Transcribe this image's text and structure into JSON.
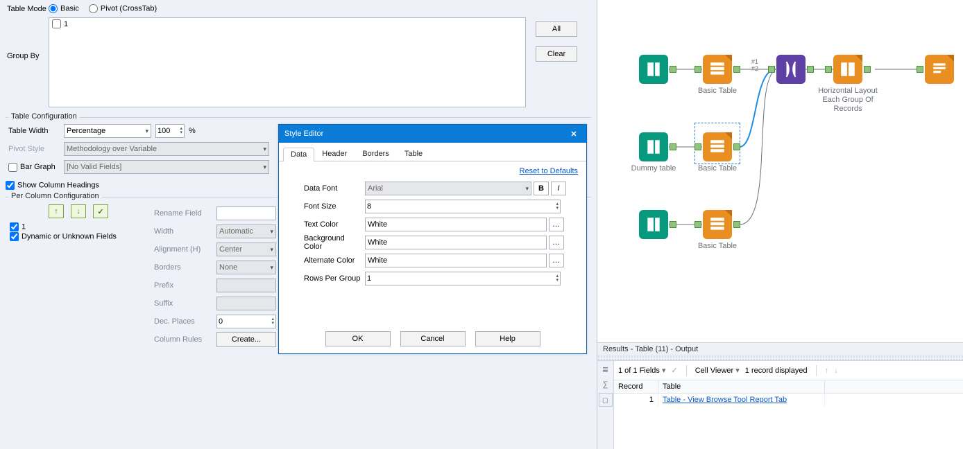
{
  "mode": {
    "label": "Table Mode",
    "basic": "Basic",
    "pivot": "Pivot (CrossTab)"
  },
  "groupby": {
    "label": "Group By",
    "item1": "1",
    "all_btn": "All",
    "clear_btn": "Clear"
  },
  "tblconf": {
    "legend": "Table Configuration",
    "width_lbl": "Table Width",
    "width_mode": "Percentage",
    "width_val": "100",
    "pct": "%",
    "pivot_lbl": "Pivot Style",
    "pivot_val": "Methodology over Variable",
    "bar_lbl": "Bar Graph",
    "bar_val": "[No Valid Fields]",
    "headings": "Show Column Headings"
  },
  "percol": {
    "legend": "Per Column Configuration",
    "f1": "1",
    "fdyn": "Dynamic or Unknown Fields",
    "rename": "Rename Field",
    "width_l": "Width",
    "width_v": "Automatic",
    "align_l": "Alignment (H)",
    "align_v": "Center",
    "borders_l": "Borders",
    "borders_v": "None",
    "prefix_l": "Prefix",
    "suffix_l": "Suffix",
    "dec_l": "Dec. Places",
    "dec_v": "0",
    "rules_l": "Column Rules",
    "rules_btn": "Create..."
  },
  "style": {
    "title": "Style Editor",
    "tabs": {
      "data": "Data",
      "header": "Header",
      "borders": "Borders",
      "table": "Table"
    },
    "reset": "Reset to Defaults",
    "font_l": "Data Font",
    "font_v": "Arial",
    "size_l": "Font Size",
    "size_v": "8",
    "tcol_l": "Text Color",
    "tcol_v": "White",
    "bgcol_l": "Background Color",
    "bgcol_v": "White",
    "alt_l": "Alternate Color",
    "alt_v": "White",
    "rpg_l": "Rows Per Group",
    "rpg_v": "1",
    "ok": "OK",
    "cancel": "Cancel",
    "help": "Help"
  },
  "canvas": {
    "bt": "Basic Table",
    "dummy": "Dummy table",
    "hlayout": "Horizontal Layout Each Group Of Records",
    "anchorwire": "#1\n#2"
  },
  "results": {
    "title": "Results - Table (11) - Output",
    "fields": "1 of 1 Fields",
    "cellviewer": "Cell Viewer",
    "recdisp": "1 record displayed",
    "col_rec": "Record",
    "col_tab": "Table",
    "row_idx": "1",
    "row_link": "Table - View Browse Tool Report Tab"
  }
}
